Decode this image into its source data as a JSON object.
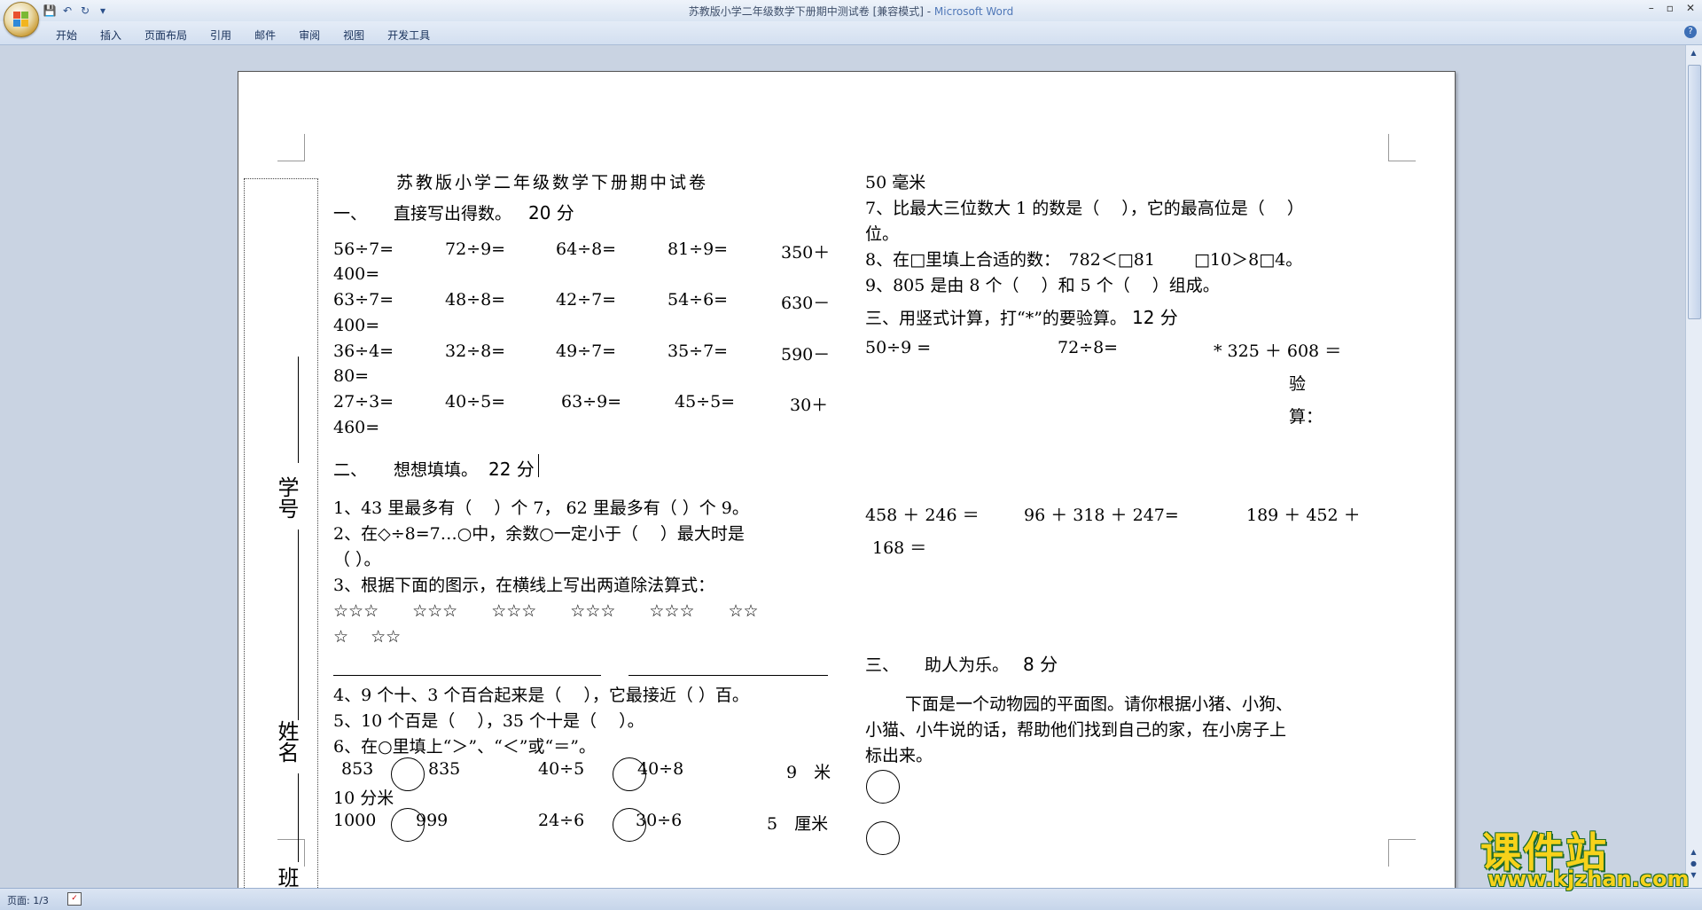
{
  "window": {
    "title": "苏教版小学二年级数学下册期中测试卷 [兼容模式] - ",
    "app_name": "Microsoft Word",
    "controls": [
      "–",
      "▫",
      "✕"
    ]
  },
  "qat": {
    "icons": [
      "save-icon",
      "undo-icon",
      "redo-icon",
      "customize-icon"
    ],
    "glyphs": [
      "💾",
      "↶",
      "↻",
      "▾"
    ]
  },
  "ribbon": {
    "tabs": [
      "开始",
      "插入",
      "页面布局",
      "引用",
      "邮件",
      "审阅",
      "视图",
      "开发工具"
    ]
  },
  "margin": {
    "labels": [
      "学号",
      "姓名",
      "班级"
    ]
  },
  "doc": {
    "title": "苏教版小学二年级数学下册期中试卷",
    "sec1": {
      "num": "一、",
      "text": "直接写出得数。",
      "score": "20 分"
    },
    "rows1": [
      [
        "56÷7=",
        "72÷9=",
        "64÷8=",
        "81÷9=",
        "350＋"
      ],
      [
        "400=",
        "",
        "",
        "",
        ""
      ],
      [
        "63÷7=",
        "48÷8=",
        "42÷7=",
        "54÷6=",
        "630－"
      ],
      [
        "400=",
        "",
        "",
        "",
        ""
      ],
      [
        "36÷4=",
        "32÷8=",
        "49÷7=",
        "35÷7=",
        "590－"
      ],
      [
        "80=",
        "",
        "",
        "",
        ""
      ],
      [
        "27÷3=",
        "40÷5=",
        "63÷9=",
        "45÷5=",
        "30＋"
      ],
      [
        "460=",
        "",
        "",
        "",
        ""
      ]
    ],
    "sec2": {
      "num": "二、",
      "text": "想想填填。",
      "score": "22 分"
    },
    "q1": "1、43 里最多有（　  ）个 7，   62 里最多有（   ）个 9。",
    "q2a": "2、在◇÷8=7…○中，余数○一定小于（　  ）最大时是",
    "q2b": "（    ）。",
    "q3": "3、根据下面的图示，在横线上写出两道除法算式：",
    "stars1": "☆☆☆　　☆☆☆　　☆☆☆　　☆☆☆　　☆☆☆　　☆☆",
    "stars2": "☆　 ☆☆",
    "q4": "4、9 个十、3 个百合起来是（　   ），它最接近（   ）百。",
    "q5": "5、10 个百是（　   ），35 个十是（　   ）。",
    "q6": "6、在○里填上“＞”、“＜”或“＝”。",
    "cmp1": [
      "853",
      "835",
      "40÷5",
      "40÷8",
      "9　米"
    ],
    "cmp1b": "10 分米",
    "cmp2": [
      "1000",
      "999",
      "24÷6",
      "30÷6",
      "5　厘米"
    ],
    "r_top": "50 毫米",
    "q7a": "7、比最大三位数大 1 的数是（　   ），它的最高位是（　  ）",
    "q7b": "位。",
    "q8": "8、在□里填上合适的数：　782＜□81　　 □10＞8□4。",
    "q9": "9、805 是由 8 个（　  ）和 5 个（　  ）组成。",
    "sec3": {
      "text": "三、用竖式计算，打“*”的要验算。",
      "score": "12 分"
    },
    "calc1": [
      "50÷9 =",
      "72÷8=",
      "* 325 ＋ 608 ＝"
    ],
    "verify": [
      "验",
      "算："
    ],
    "calc2": [
      "458 ＋ 246 ＝",
      "96 ＋ 318 ＋ 247=",
      "189 ＋ 452 ＋"
    ],
    "calc2b": "168 ＝",
    "sec4": {
      "num": "三、",
      "text": "助人为乐。",
      "score": "8 分"
    },
    "zoo1": "下面是一个动物园的平面图。请你根据小猪、小狗、",
    "zoo2": "小猫、小牛说的话，帮助他们找到自己的家，在小房子上",
    "zoo3": "标出来。"
  },
  "status": {
    "page": "页面: 1/3"
  },
  "watermark": {
    "title": "课件站",
    "url": "www.kjzhan.com"
  }
}
